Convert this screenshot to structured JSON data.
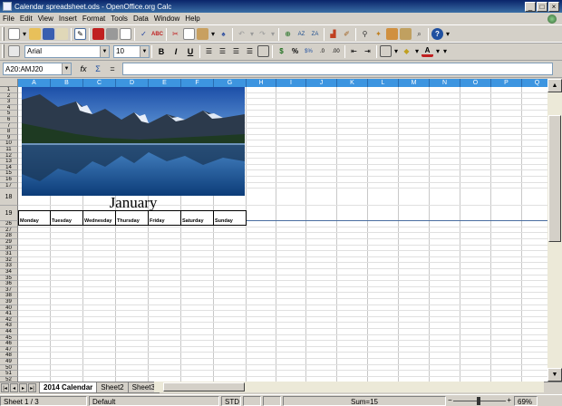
{
  "window": {
    "title": "Calendar spreadsheet.ods - OpenOffice.org Calc",
    "min": "_",
    "max": "□",
    "close": "×"
  },
  "menu": [
    "File",
    "Edit",
    "View",
    "Insert",
    "Format",
    "Tools",
    "Data",
    "Window",
    "Help"
  ],
  "format_toolbar": {
    "font_name": "Arial",
    "font_size": "10",
    "bold": "B",
    "italic": "I",
    "underline": "U"
  },
  "formula_bar": {
    "name_box": "A20:AMJ20",
    "function_wizard": "fx",
    "sum": "Σ",
    "equals": "=",
    "formula": ""
  },
  "sheet": {
    "columns": [
      "A",
      "B",
      "C",
      "D",
      "E",
      "F",
      "G",
      "H",
      "I",
      "J",
      "K",
      "L",
      "M",
      "N",
      "O",
      "P",
      "Q"
    ],
    "rows": [
      "1",
      "2",
      "3",
      "4",
      "5",
      "6",
      "7",
      "8",
      "9",
      "10",
      "11",
      "12",
      "13",
      "14",
      "15",
      "16",
      "17",
      "18",
      "19",
      "26",
      "27",
      "28",
      "29",
      "30",
      "31",
      "32",
      "33",
      "34",
      "35",
      "36",
      "37",
      "38",
      "39",
      "40",
      "41",
      "42",
      "43",
      "44",
      "45",
      "46",
      "47",
      "48",
      "49",
      "50",
      "51",
      "52"
    ],
    "month": "January",
    "days": [
      "Monday",
      "Tuesday",
      "Wednesday",
      "Thursday",
      "Friday",
      "Saturday",
      "Sunday"
    ]
  },
  "tabs": {
    "items": [
      "2014 Calendar",
      "Sheet2",
      "Sheet3"
    ],
    "active_index": 0
  },
  "status": {
    "sheet": "Sheet 1 / 3",
    "style": "Default",
    "mode": "STD",
    "sum": "Sum=15",
    "zoom": "69%",
    "zoom_level": 0.69
  }
}
